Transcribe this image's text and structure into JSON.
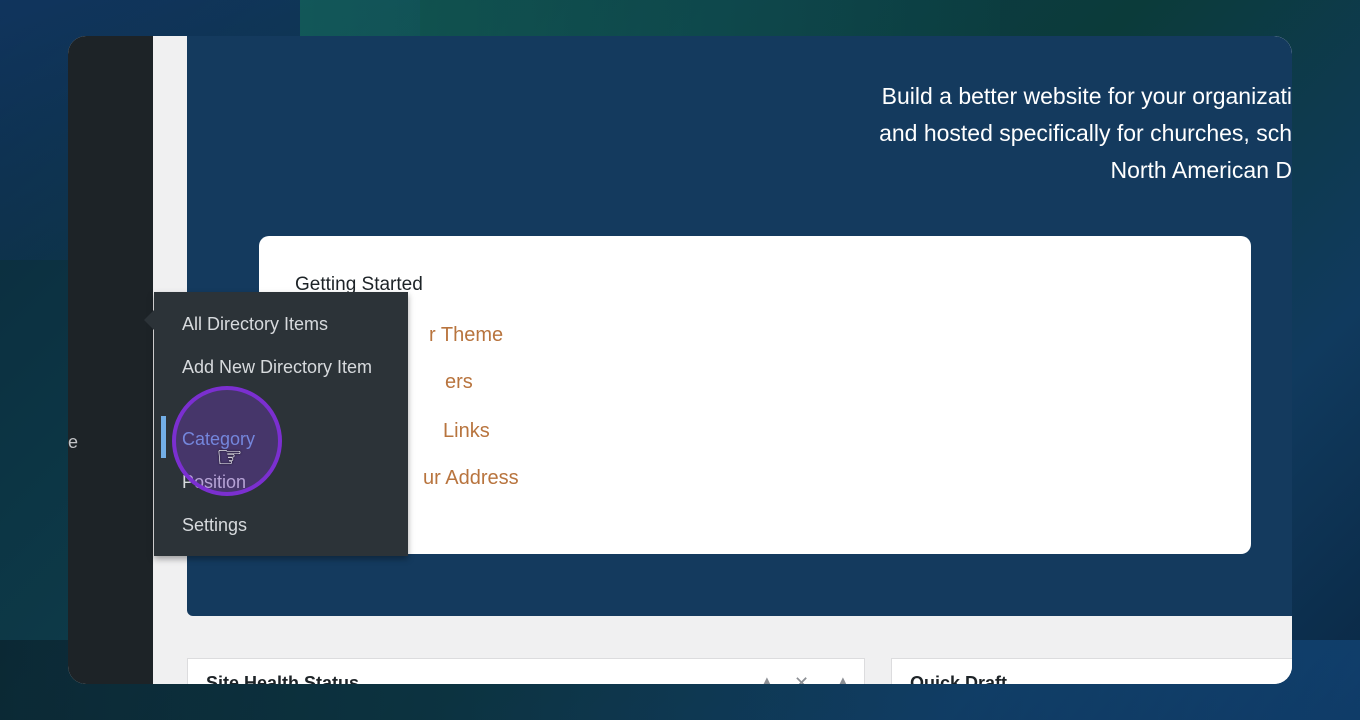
{
  "sidebar": {
    "fragment": "e"
  },
  "hero": {
    "lines": [
      "Build a better website for your organizati",
      "and hosted specifically for churches, sch",
      "North American D"
    ]
  },
  "getting_started": {
    "title": "Getting Started",
    "links": [
      "r Theme",
      "ers",
      "Links",
      "ur Address"
    ]
  },
  "flyout_menu": {
    "items": [
      {
        "label": "All Directory Items"
      },
      {
        "label": "Add New Directory Item"
      },
      {
        "label": "Category",
        "current": true
      },
      {
        "label": "Position"
      },
      {
        "label": "Settings"
      }
    ]
  },
  "widgets": {
    "site_health_title": "Site Health Status",
    "quick_draft_title": "Quick Draft"
  },
  "icons": {
    "cursor": "pointer-hand-icon",
    "widget_up": "chevron-up-icon",
    "widget_close": "close-icon"
  },
  "colors": {
    "hero_bg": "#143a5e",
    "link": "#b8743e",
    "flyout_bg": "#2c3338",
    "current": "#72aee6",
    "click_ring": "#7b2fd0"
  }
}
